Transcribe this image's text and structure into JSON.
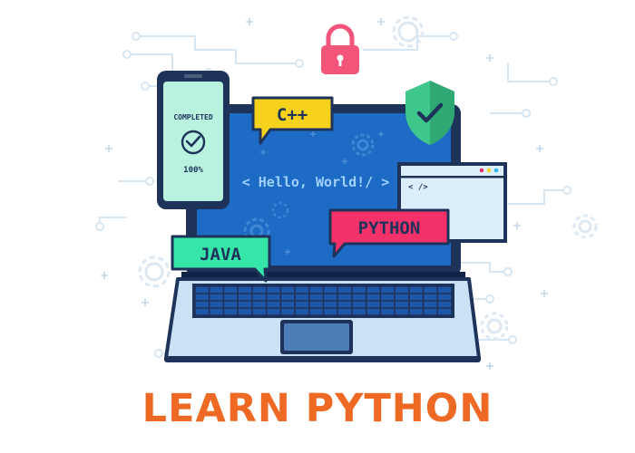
{
  "phone": {
    "status_label": "COMPLETED",
    "progress_label": "100%",
    "progress": 1.0
  },
  "bubbles": {
    "cpp": "C++",
    "python": "PYTHON",
    "java": "JAVA"
  },
  "code_window": {
    "tag": "< />",
    "dots": 3
  },
  "screen": {
    "code_text": "< Hello, World!/ >"
  },
  "title": "LEARN PYTHON",
  "colors": {
    "title": "#ee6a24",
    "dark_navy": "#1e3359",
    "screen_blue": "#1d6bc4",
    "cpp_bubble": "#f7d21d",
    "python_bubble": "#f4316b",
    "java_bubble": "#36e5a8",
    "shield": "#3fc68a",
    "lock": "#f25579",
    "phone_screen": "#b9f3e0",
    "keyboard_key": "#1d57a8",
    "laptop_base": "#c9e2f5"
  },
  "icons": [
    "check-circle-icon",
    "lock-icon",
    "shield-check-icon",
    "gear-icon",
    "plus-icon"
  ]
}
